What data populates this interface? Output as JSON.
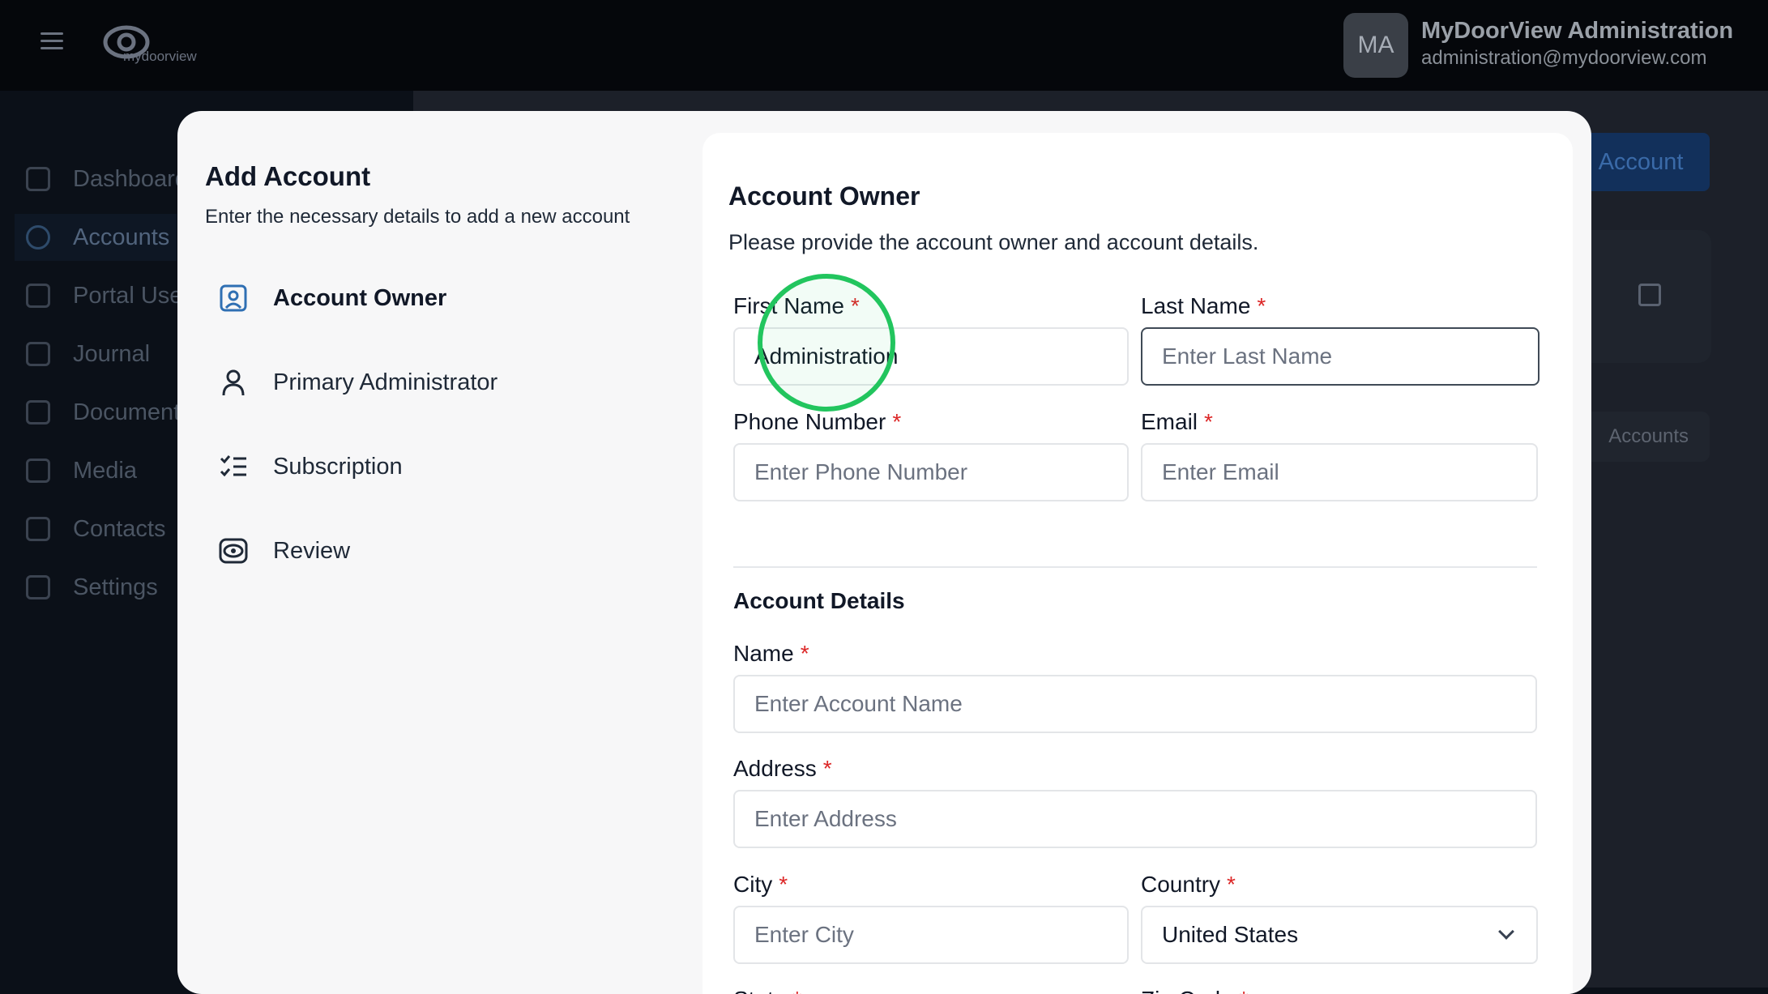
{
  "header": {
    "logo_text": "mydoorview",
    "user_initials": "MA",
    "user_name": "MyDoorView Administration",
    "user_email": "administration@mydoorview.com"
  },
  "sidebar": {
    "items": [
      {
        "label": "Dashboard",
        "icon": "bar-chart-icon"
      },
      {
        "label": "Accounts",
        "icon": "users-icon"
      },
      {
        "label": "Portal Users",
        "icon": "list-icon"
      },
      {
        "label": "Journal",
        "icon": "calendar-icon"
      },
      {
        "label": "Documents",
        "icon": "document-icon"
      },
      {
        "label": "Media",
        "icon": "media-icon"
      },
      {
        "label": "Contacts",
        "icon": "contacts-icon"
      },
      {
        "label": "Settings",
        "icon": "gear-icon"
      }
    ]
  },
  "background": {
    "primary_button": "Account",
    "tab_label": "Accounts"
  },
  "modal": {
    "title": "Add Account",
    "subtitle": "Enter the necessary details to add a new account",
    "steps": [
      {
        "label": "Account Owner",
        "icon": "user-badge-icon",
        "active": true
      },
      {
        "label": "Primary Administrator",
        "icon": "user-icon",
        "active": false
      },
      {
        "label": "Subscription",
        "icon": "checklist-icon",
        "active": false
      },
      {
        "label": "Review",
        "icon": "eye-icon",
        "active": false
      }
    ]
  },
  "form": {
    "title": "Account Owner",
    "subtitle": "Please provide the account owner and account details.",
    "required_mark": "*",
    "first_name": {
      "label": "First Name",
      "value": "Administration"
    },
    "last_name": {
      "label": "Last Name",
      "placeholder": "Enter Last Name"
    },
    "phone": {
      "label": "Phone Number",
      "placeholder": "Enter Phone Number"
    },
    "email": {
      "label": "Email",
      "placeholder": "Enter Email"
    },
    "account_details_title": "Account Details",
    "name": {
      "label": "Name",
      "placeholder": "Enter Account Name"
    },
    "address": {
      "label": "Address",
      "placeholder": "Enter Address"
    },
    "city": {
      "label": "City",
      "placeholder": "Enter City"
    },
    "country": {
      "label": "Country",
      "value": "United States"
    },
    "state": {
      "label": "State"
    },
    "zip": {
      "label": "Zip Code"
    }
  }
}
